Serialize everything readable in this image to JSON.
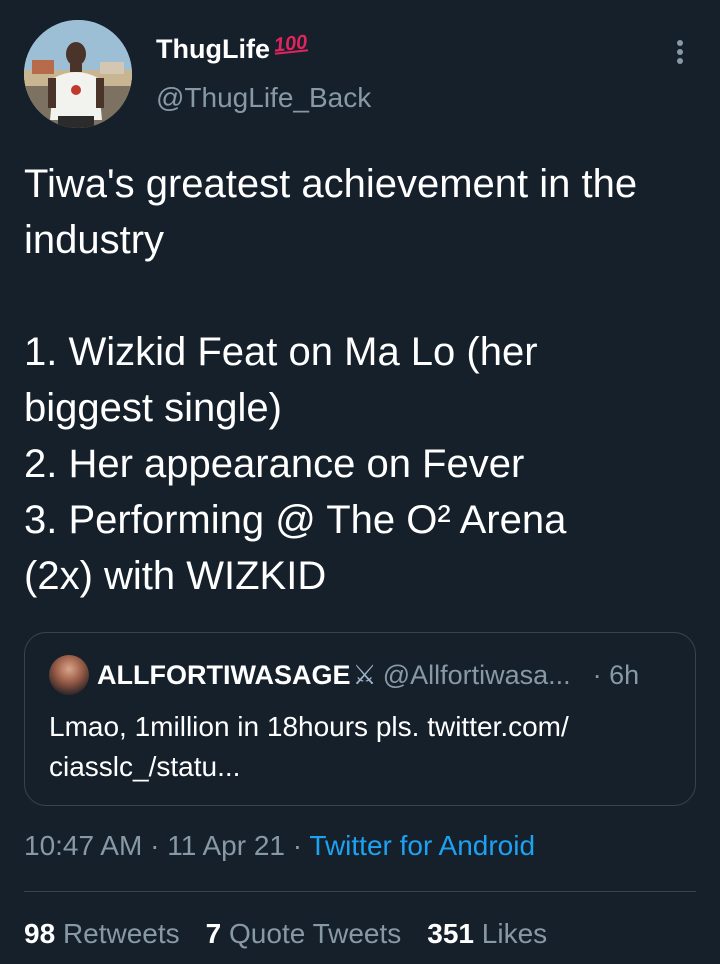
{
  "author": {
    "display_name": "ThugLife",
    "emoji": "100",
    "handle": "@ThugLife_Back"
  },
  "tweet": {
    "lines": [
      "Tiwa's greatest achievement in the",
      "industry",
      "",
      "1. Wizkid Feat on Ma Lo (her",
      "biggest single)",
      "2. Her appearance on Fever",
      "3. Performing @ The O² Arena",
      "(2x) with WIZKID"
    ]
  },
  "quote": {
    "display_name": "ALLFORTIWASAGE",
    "badge_icon": "crossed-swords",
    "handle": "@Allfortiwasa...",
    "time": "· 6h",
    "text_line1": "Lmao, 1million in 18hours pls. twitter.com/",
    "text_line2": "ciasslc_/statu..."
  },
  "meta": {
    "time": "10:47 AM",
    "sep1": " · ",
    "date": "11 Apr 21",
    "sep2": " · ",
    "source": "Twitter for Android"
  },
  "stats": {
    "retweets_count": "98",
    "retweets_label": "Retweets",
    "quotes_count": "7",
    "quotes_label": "Quote Tweets",
    "likes_count": "351",
    "likes_label": "Likes"
  },
  "colors": {
    "background": "#15202b",
    "secondary_text": "#8899a6",
    "link": "#1da1f2",
    "border": "#38444d"
  }
}
